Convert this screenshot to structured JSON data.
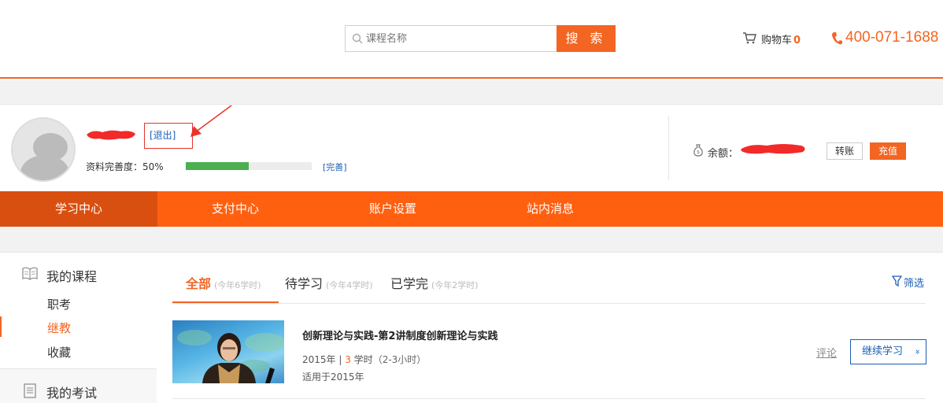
{
  "header": {
    "search_placeholder": "课程名称",
    "search_button": "搜 索",
    "cart_label": "购物车",
    "cart_count": "0",
    "phone": "400-071-1688"
  },
  "profile": {
    "logout": "[退出]",
    "completeness_label": "资料完善度：50%",
    "completeness_fraction": 0.5,
    "complete_link": "[完善]",
    "balance_label": "余额：",
    "transfer_button": "转账",
    "recharge_button": "充值"
  },
  "nav": {
    "items": [
      "学习中心",
      "支付中心",
      "账户设置",
      "站内消息"
    ]
  },
  "sidebar": {
    "my_courses": "我的课程",
    "sub_items": [
      "职考",
      "继教",
      "收藏"
    ],
    "my_exams": "我的考试"
  },
  "tabs": {
    "all": "全部",
    "all_sub": "(今年6学时)",
    "todo": "待学习",
    "todo_sub": "(今年4学时)",
    "done": "已学完",
    "done_sub": "(今年2学时)",
    "filter": "筛选"
  },
  "course": {
    "title": "创新理论与实践-第2讲制度创新理论与实践",
    "year": "2015年",
    "sep": " | ",
    "hours": "3",
    "hours_unit": " 学时",
    "duration": "（2-3小时）",
    "applies": "适用于2015年",
    "review": "评论",
    "continue": "继续学习",
    "continue_chev": "»"
  },
  "colors": {
    "accent": "#f26522",
    "nav_bg": "#ff6010",
    "nav_active": "#d94f10",
    "link": "#1a5fb4",
    "progress": "#4caf50"
  }
}
